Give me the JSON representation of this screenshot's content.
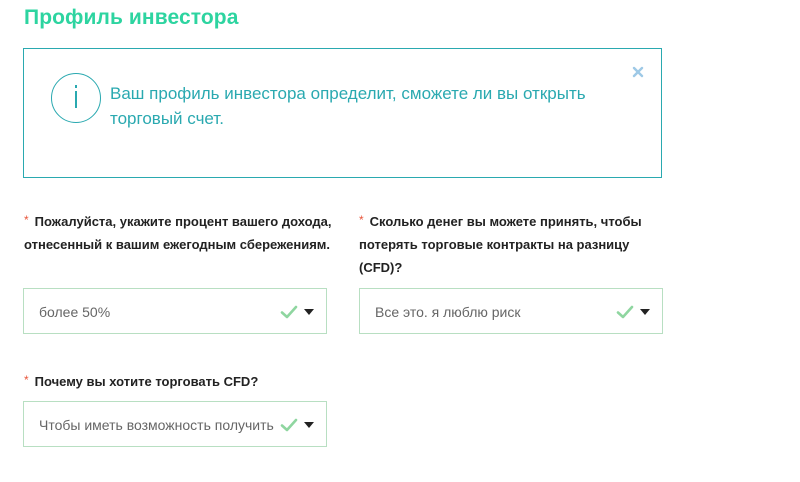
{
  "page": {
    "title": "Профиль инвестора"
  },
  "info_alert": {
    "text": "Ваш профиль инвестора определит, сможете ли вы открыть торговый счет.",
    "icon": "info-icon",
    "close_icon": "close-icon",
    "accent_color": "#2aa9b0"
  },
  "form": {
    "required_marker": "*",
    "questions": [
      {
        "label": "Пожалуйста, укажите процент вашего дохода, отнесенный к вашим ежегодным сбережениям.",
        "selected_value": "более 50%"
      },
      {
        "label": "Сколько денег вы можете принять, чтобы потерять торговые контракты на разницу (CFD)?",
        "selected_value": "Все это. я люблю риск"
      },
      {
        "label": "Почему вы хотите торговать CFD?",
        "selected_value": "Чтобы иметь возможность получить"
      }
    ]
  },
  "colors": {
    "title": "#2dd4a0",
    "valid_check": "#8fd6a0",
    "required": "#e8553b",
    "select_border": "#b8dfc2"
  }
}
